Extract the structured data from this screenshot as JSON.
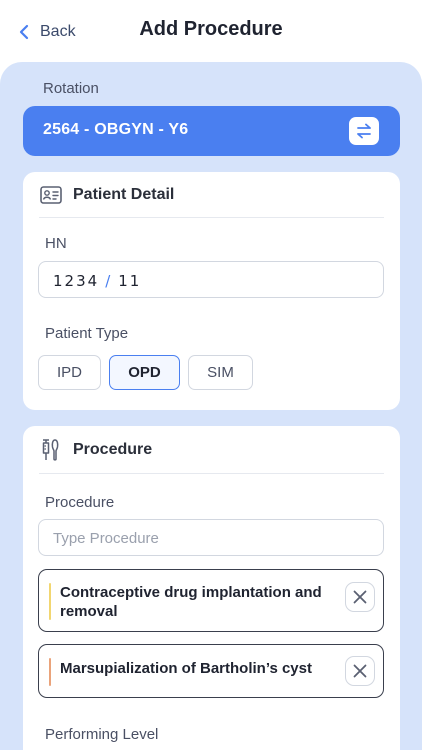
{
  "header": {
    "back_label": "Back",
    "title": "Add Procedure"
  },
  "rotation": {
    "label": "Rotation",
    "value": "2564 - OBGYN - Y6"
  },
  "patient_detail": {
    "title": "Patient Detail",
    "hn_label": "HN",
    "hn_part1": "1234",
    "hn_separator": "/",
    "hn_part2": "11",
    "patient_type_label": "Patient Type",
    "types": [
      "IPD",
      "OPD",
      "SIM"
    ],
    "selected_type": "OPD"
  },
  "procedure": {
    "title": "Procedure",
    "field_label": "Procedure",
    "placeholder": "Type Procedure",
    "items": [
      {
        "text": "Contraceptive drug implantation and removal",
        "line1": "Contraceptive drug implantation and",
        "line2": "removal",
        "accent": "#f2d670"
      },
      {
        "text": "Marsupialization of Bartholin’s cyst",
        "accent": "#eaa37a"
      }
    ],
    "performing_level_label": "Performing Level"
  },
  "colors": {
    "primary": "#4a7ff0",
    "panel_bg": "#d6e3fa"
  }
}
